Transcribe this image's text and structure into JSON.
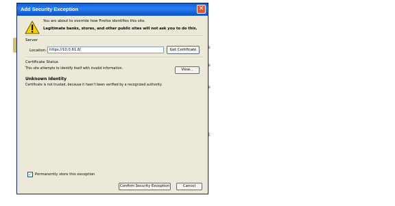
{
  "dialog": {
    "title": "Add Security Exception",
    "close_glyph": "✕",
    "intro_line1": "You are about to override how Firefox identifies this site.",
    "intro_line2": "Legitimate banks, stores, and other public sites will not ask you to do this.",
    "server": {
      "section_label": "Server",
      "location_label": "Location:",
      "location_value": "https://10.0.61.8/",
      "get_certificate_label": "Get Certificate"
    },
    "certificate_status": {
      "section_label": "Certificate Status",
      "description": "This site attempts to identify itself with invalid information.",
      "view_label": "View...",
      "unknown_identity_heading": "Unknown Identity",
      "unknown_identity_text": "Certificate is not trusted, because it hasn't been verified by a recognized authority."
    },
    "permanent_store": {
      "label": "Permanently store this exception",
      "checked": true,
      "check_glyph": "✓"
    },
    "buttons": {
      "confirm_label": "Confirm Security Exception",
      "cancel_label": "Cancel"
    }
  },
  "icons": {
    "warning": "warning-icon",
    "close": "close-icon"
  },
  "colors": {
    "titlebar": "#0a5fd8",
    "dialog_bg": "#ece9d8",
    "close_button": "#e2552f",
    "warning_yellow": "#f5d000"
  },
  "background": {
    "fragments": [
      "e",
      "e",
      "e",
      "E"
    ]
  }
}
